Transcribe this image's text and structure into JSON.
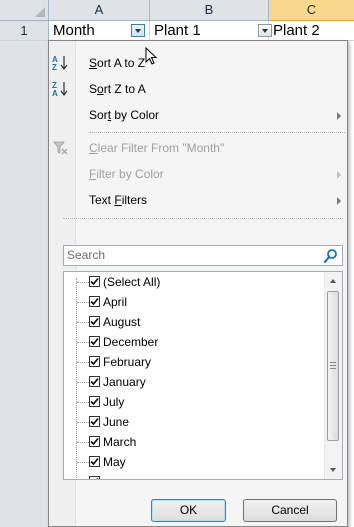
{
  "sheet": {
    "columns": [
      "A",
      "B",
      "C"
    ],
    "row_number": "1",
    "cells": [
      "Month",
      "Plant 1",
      "Plant 2"
    ]
  },
  "menu": {
    "sort_az": {
      "pre": "",
      "key": "S",
      "post": "ort A to Z"
    },
    "sort_za": {
      "pre": "S",
      "key": "o",
      "post": "rt Z to A"
    },
    "sort_color": {
      "pre": "Sor",
      "key": "t",
      "post": " by Color"
    },
    "clear_filter": {
      "pre": "",
      "key": "C",
      "post": "lear Filter From \"Month\""
    },
    "filter_color": {
      "pre": "",
      "key": "F",
      "post": "ilter by Color"
    },
    "text_filters": {
      "pre": "Text ",
      "key": "F",
      "post": "ilters"
    },
    "search_placeholder": "Search",
    "items": [
      "(Select All)",
      "April",
      "August",
      "December",
      "February",
      "January",
      "July",
      "June",
      "March",
      "May"
    ],
    "ok_label": "OK",
    "cancel_label": "Cancel"
  },
  "colors": {
    "selected_column_header": "#f9d98d",
    "menu_background": "#f5f5f5",
    "disabled_text": "#a0a0a0",
    "search_icon": "#1c6fb8"
  },
  "icons": [
    "sort-az-icon",
    "sort-za-icon",
    "clear-filter-icon",
    "search-icon",
    "checkbox-check-icon",
    "mouse-cursor-icon"
  ]
}
